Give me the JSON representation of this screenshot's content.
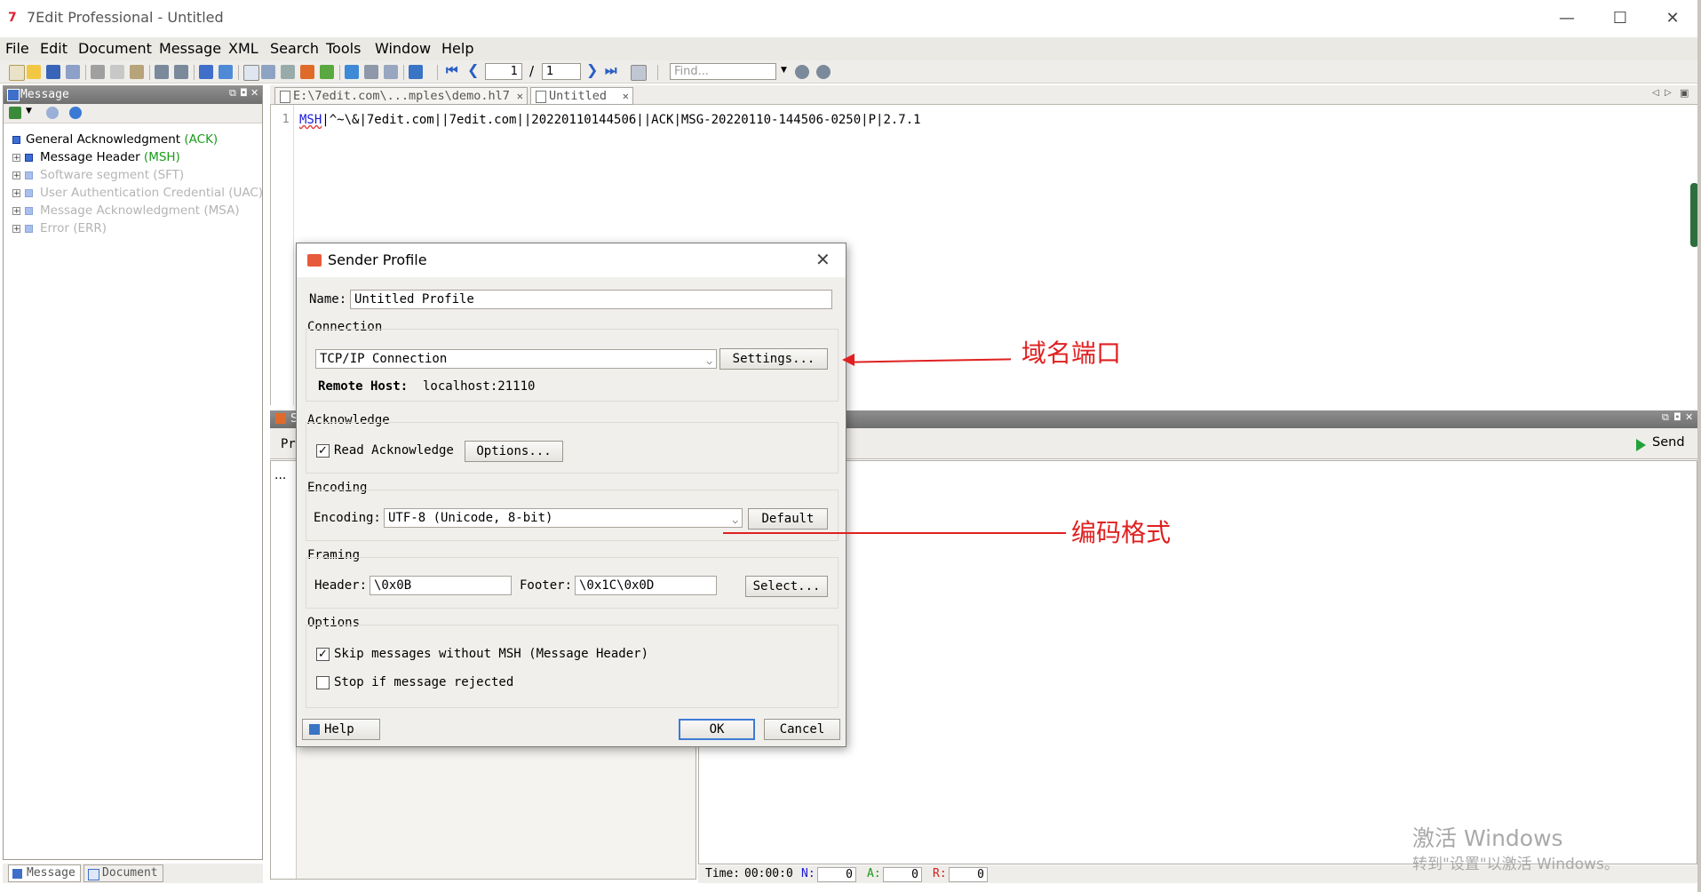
{
  "window": {
    "title": "7Edit Professional - Untitled",
    "minimize": "—",
    "maximize": "☐",
    "close": "✕"
  },
  "menu": [
    "File",
    "Edit",
    "Document",
    "Message",
    "XML",
    "Search",
    "Tools",
    "Window",
    "Help"
  ],
  "toolbar": {
    "page_current": "1",
    "page_separator": "/",
    "page_total": "1",
    "find_placeholder": "Find..."
  },
  "left_panel": {
    "title": "Message",
    "tree": [
      {
        "label": "General Acknowledgment",
        "code": "(ACK)",
        "faded": false,
        "root": true
      },
      {
        "label": "Message Header",
        "code": "(MSH)",
        "faded": false
      },
      {
        "label": "Software segment (SFT)",
        "code": "",
        "faded": true
      },
      {
        "label": "User Authentication Credential (UAC)",
        "code": "",
        "faded": true
      },
      {
        "label": "Message Acknowledgment (MSA)",
        "code": "",
        "faded": true
      },
      {
        "label": "Error (ERR)",
        "code": "",
        "faded": true
      }
    ],
    "bottom_tabs": [
      "Message",
      "Document"
    ]
  },
  "editor": {
    "tabs": [
      {
        "label": "E:\\7edit.com\\...mples\\demo.hl7",
        "close": "✕"
      },
      {
        "label": "Untitled",
        "close": "✕"
      }
    ],
    "line_number": "1",
    "hl7_segment": "MSH",
    "hl7_rest": "|^~\\&|7edit.com||7edit.com||20220110144506||ACK|MSG-20220110-144506-0250|P|2.7.1"
  },
  "send_panel": {
    "send_label": "Send",
    "left_partial_header": "S",
    "left_partial_label": "Pr",
    "left_partial_item": "...",
    "status": {
      "time_label": "Time:",
      "time_value": "00:00:0",
      "n_label": "N:",
      "n_value": "0",
      "a_label": "A:",
      "a_value": "0",
      "r_label": "R:",
      "r_value": "0"
    }
  },
  "dialog": {
    "title": "Sender Profile",
    "name_label": "Name:",
    "name_value": "Untitled Profile",
    "connection_group": "Connection",
    "connection_value": "TCP/IP Connection",
    "settings_button": "Settings...",
    "remote_host_label": "Remote Host:",
    "remote_host_value": "localhost:21110",
    "acknowledge_group": "Acknowledge",
    "read_ack_label": "Read Acknowledge",
    "read_ack_checked": true,
    "options_button": "Options...",
    "encoding_group": "Encoding",
    "encoding_label": "Encoding:",
    "encoding_value": "UTF-8 (Unicode, 8-bit)",
    "default_button": "Default",
    "framing_group": "Framing",
    "header_label": "Header:",
    "header_value": "\\0x0B",
    "footer_label": "Footer:",
    "footer_value": "\\0x1C\\0x0D",
    "select_button": "Select...",
    "options_group": "Options",
    "skip_label": "Skip messages without MSH (Message Header)",
    "skip_checked": true,
    "stop_label": "Stop if message rejected",
    "stop_checked": false,
    "help_button": "Help",
    "ok_button": "OK",
    "cancel_button": "Cancel"
  },
  "annotations": {
    "domain_port": "域名端口",
    "encoding_format": "编码格式"
  },
  "watermark": {
    "line1": "激活 Windows",
    "line2": "转到\"设置\"以激活 Windows。"
  },
  "colors": {
    "annotation": "#e02020",
    "panel_header": "#7f7f7f",
    "ack_code": "#1a9a1a",
    "hl7_segment": "#1a1ad6"
  }
}
